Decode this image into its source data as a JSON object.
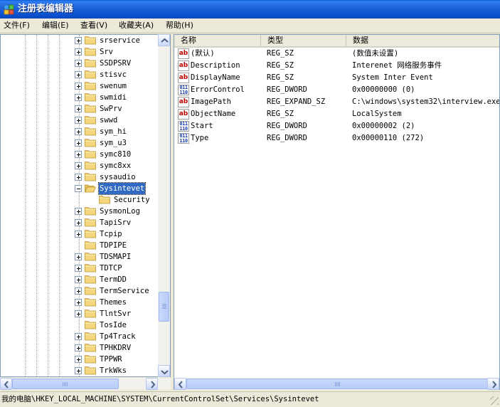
{
  "window": {
    "title": "注册表编辑器"
  },
  "menu": [
    {
      "label": "文件(F)"
    },
    {
      "label": "编辑(E)"
    },
    {
      "label": "查看(V)"
    },
    {
      "label": "收藏夹(A)"
    },
    {
      "label": "帮助(H)"
    }
  ],
  "tree": {
    "nodes": [
      {
        "label": "srservice",
        "expander": "plus"
      },
      {
        "label": "Srv",
        "expander": "plus"
      },
      {
        "label": "SSDPSRV",
        "expander": "plus"
      },
      {
        "label": "stisvc",
        "expander": "plus"
      },
      {
        "label": "swenum",
        "expander": "plus"
      },
      {
        "label": "swmidi",
        "expander": "plus"
      },
      {
        "label": "SwPrv",
        "expander": "plus"
      },
      {
        "label": "swwd",
        "expander": "plus"
      },
      {
        "label": "sym_hi",
        "expander": "plus"
      },
      {
        "label": "sym_u3",
        "expander": "plus"
      },
      {
        "label": "symc810",
        "expander": "plus"
      },
      {
        "label": "symc8xx",
        "expander": "plus"
      },
      {
        "label": "sysaudio",
        "expander": "plus"
      },
      {
        "label": "Sysintevet",
        "expander": "minus",
        "selected": true
      },
      {
        "label": "Security",
        "expander": "none",
        "child": true
      },
      {
        "label": "SysmonLog",
        "expander": "plus"
      },
      {
        "label": "TapiSrv",
        "expander": "plus"
      },
      {
        "label": "Tcpip",
        "expander": "plus"
      },
      {
        "label": "TDPIPE",
        "expander": "none"
      },
      {
        "label": "TDSMAPI",
        "expander": "plus"
      },
      {
        "label": "TDTCP",
        "expander": "plus"
      },
      {
        "label": "TermDD",
        "expander": "plus"
      },
      {
        "label": "TermService",
        "expander": "plus"
      },
      {
        "label": "Themes",
        "expander": "plus"
      },
      {
        "label": "TlntSvr",
        "expander": "plus"
      },
      {
        "label": "TosIde",
        "expander": "none"
      },
      {
        "label": "Tp4Track",
        "expander": "plus"
      },
      {
        "label": "TPHKDRV",
        "expander": "plus"
      },
      {
        "label": "TPPWR",
        "expander": "plus"
      },
      {
        "label": "TrkWks",
        "expander": "plus"
      }
    ]
  },
  "list": {
    "columns": [
      "名称",
      "类型",
      "数据"
    ],
    "rows": [
      {
        "icon": "string-value-icon",
        "name": "(默认)",
        "type": "REG_SZ",
        "data": "(数值未设置)"
      },
      {
        "icon": "string-value-icon",
        "name": "Description",
        "type": "REG_SZ",
        "data": "Interenet 网络服务事件"
      },
      {
        "icon": "string-value-icon",
        "name": "DisplayName",
        "type": "REG_SZ",
        "data": "System Inter Event"
      },
      {
        "icon": "dword-value-icon",
        "name": "ErrorControl",
        "type": "REG_DWORD",
        "data": "0x00000000 (0)"
      },
      {
        "icon": "string-value-icon",
        "name": "ImagePath",
        "type": "REG_EXPAND_SZ",
        "data": "C:\\windows\\system32\\interview.exe"
      },
      {
        "icon": "string-value-icon",
        "name": "ObjectName",
        "type": "REG_SZ",
        "data": "LocalSystem"
      },
      {
        "icon": "dword-value-icon",
        "name": "Start",
        "type": "REG_DWORD",
        "data": "0x00000002 (2)"
      },
      {
        "icon": "dword-value-icon",
        "name": "Type",
        "type": "REG_DWORD",
        "data": "0x00000110 (272)"
      }
    ]
  },
  "statusbar": {
    "path": "我的电脑\\HKEY_LOCAL_MACHINE\\SYSTEM\\CurrentControlSet\\Services\\Sysintevet"
  },
  "colors": {
    "titlebar": "#0B4FCF",
    "selection": "#316AC5",
    "folder": "#F5D47B"
  }
}
